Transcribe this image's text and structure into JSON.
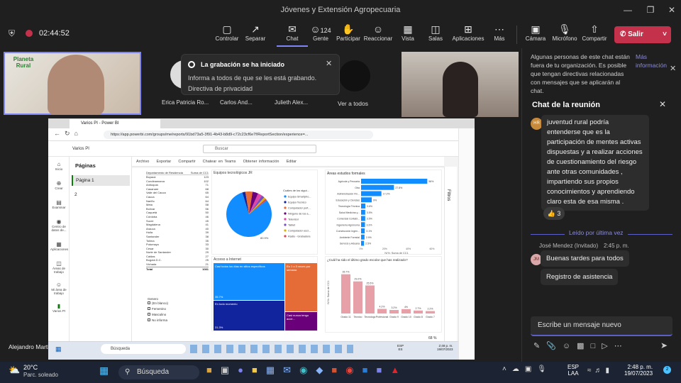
{
  "window": {
    "title": "Jóvenes y Extensión Agropecuaria"
  },
  "meeting": {
    "timer": "02:44:52",
    "participants_count": "124"
  },
  "toolbar": {
    "controlar": "Controlar",
    "separar": "Separar",
    "chat": "Chat",
    "gente": "Gente",
    "participar": "Participar",
    "reaccionar": "Reaccionar",
    "vista": "Vista",
    "salas": "Salas",
    "aplicaciones": "Aplicaciones",
    "mas": "Más",
    "camara": "Cámara",
    "microfono": "Micrófono",
    "compartir": "Compartir",
    "salir": "Salir"
  },
  "recording": {
    "title": "La grabación se ha iniciado",
    "body": "Informa a todos de que se les está grabando.",
    "link": "Directiva de privacidad"
  },
  "participants": {
    "tile_logo": "Planeta Rural",
    "names": [
      "Erica Patricia Ro...",
      "Carlos And...",
      "Julieth Alex..."
    ],
    "ver_todos": "Ver a todos",
    "presenter": "Alejandro Martinez"
  },
  "chat": {
    "notice": "Algunas personas de este chat están fuera de tu organización. Es posible que tengan directivas relacionadas con mensajes que se aplicarán al chat.",
    "notice_link": "Más información",
    "title": "Chat de la reunión",
    "message_text": "juventud rural podría entenderse que es la participación de mentes activas dispuestas y a realizar acciones de cuestionamiento del riesgo ante otras comunidades , impartiendo sus propios conocimientos y aprendiendo claro esta de esa misma .",
    "avatar_initials": "HR",
    "reaction_count": "3",
    "read_marker": "Leído por última vez",
    "sender": "José Mendez (Invitado)",
    "time": "2:45 p. m.",
    "sender_initials": "JM",
    "msg1": "Buenas tardes para todos",
    "msg2": "Registro de asistencia",
    "input_placeholder": "Escribe un mensaje nuevo"
  },
  "browser": {
    "tab": "Varios PI - Power BI",
    "url": "https://app.powerbi.com/groups/me/reports/91bd73a5-3f91-4b43-b8d9-c72c23cf6e7f/ReportSection/experience=...",
    "workspace": "Varios PI",
    "search": "Buscar",
    "menu": [
      "Archivo",
      "Exportar",
      "Compartir",
      "Chatear en Teams",
      "Obtener información",
      "Editar"
    ],
    "pages_title": "Páginas",
    "pages": [
      "Página 1",
      "2"
    ],
    "filters": "Filtros",
    "zoom": "68 %"
  },
  "leftnav": [
    "Inicio",
    "Crear",
    "Examinar",
    "Centro de datos de...",
    "Aplicaciones",
    "Áreas de trabajo",
    "Mi área de trabajo",
    "Varios PI"
  ],
  "table": {
    "headers": [
      "Departamento de Residencia",
      "Suma de CC1"
    ],
    "rows": [
      [
        "Boyacá",
        "123"
      ],
      [
        "Cundinamarca",
        "102"
      ],
      [
        "Antioquia",
        "71"
      ],
      [
        "Casanare",
        "68"
      ],
      [
        "Valle del Cauca",
        "65"
      ],
      [
        "Cauca",
        "64"
      ],
      [
        "Nariño",
        "64"
      ],
      [
        "Meta",
        "58"
      ],
      [
        "Bolívar",
        "56"
      ],
      [
        "Caquetá",
        "50"
      ],
      [
        "Córdoba",
        "46"
      ],
      [
        "Sucre",
        "45"
      ],
      [
        "Magdalena",
        "41"
      ],
      [
        "Arauca",
        "40"
      ],
      [
        "Huila",
        "39"
      ],
      [
        "Santander",
        "38"
      ],
      [
        "Tolima",
        "35"
      ],
      [
        "Putumayo",
        "33"
      ],
      [
        "Cesar",
        "30"
      ],
      [
        "Norte de Santander",
        "29"
      ],
      [
        "Caldas",
        "27"
      ],
      [
        "Bogotá D.C.",
        "25"
      ],
      [
        "Vichada",
        "21"
      ]
    ],
    "total_label": "Total",
    "total": "1081",
    "filter_title": "Genero",
    "filter_options": [
      "(En blanco)",
      "Femenino",
      "Masculino",
      "No informa"
    ]
  },
  "chart_pie": {
    "title": "Equipos tecnológicos JR",
    "legend_title": "Cuáles de los sigui...",
    "legend": [
      "Equipo Smartpho...",
      "Equipo Tecnico",
      "Computador port...",
      "Ninguno de los a...",
      "Televisor",
      "Tablet",
      "Computador escr...",
      "Radio - Grabadora"
    ],
    "colors": [
      "#118dff",
      "#12239e",
      "#e66c37",
      "#6b007b",
      "#e044a7",
      "#744ec2",
      "#d9b300",
      "#d64550"
    ]
  },
  "chart_data": [
    {
      "type": "pie",
      "title": "Equipos tecnológicos JR",
      "labels": [
        "Equipo Smartpho...",
        "Equipo Tecnico",
        "Computador port...",
        "Ninguno de los a...",
        "Televisor",
        "Tablet",
        "Computador escr...",
        "Radio - Grabadora"
      ],
      "values": [
        80.9,
        2.2,
        5.1,
        4.1,
        3.0,
        2.1,
        1.5,
        1.1
      ]
    },
    {
      "type": "bar",
      "title": "Áreas estudios formales",
      "xlabel": "N/%: Suma de CC1",
      "categories": [
        "Agrícola y Pecuaria",
        "Otra",
        "Administración Fin...",
        "Educación y Ciencias",
        "Tecnología Técnica",
        "Salud Medicina y...",
        "Comercial Contabi...",
        "Ingeniería Agrónoma",
        "Construcción Ingen...",
        "Ambiente Forestal",
        "Servicio y Aduana"
      ],
      "values": [
        56.0,
        27.8,
        17.2,
        9.0,
        3.6,
        3.5,
        3.5,
        3.3,
        3.1,
        2.9,
        2.5
      ],
      "xlim": [
        0,
        60
      ]
    },
    {
      "type": "bar",
      "title": "¿Cuál ha sido el último grado escolar que has realizado?",
      "ylabel": "N/%: Suma de CC1",
      "categories": [
        "Grado 11",
        "Tecnico",
        "Tecnólogo",
        "Profesional",
        "Grado 9",
        "Grado 10",
        "Grado 8",
        "Grado 7"
      ],
      "values": [
        35.7,
        29.2,
        25.5,
        4.2,
        3.2,
        4.0,
        2.7,
        2.2
      ],
      "ylim": [
        0,
        40
      ]
    }
  ],
  "treemap": {
    "title": "Acceso a Internet",
    "cells": [
      "Casi todos los días en sitios específicos",
      "En 1 o 3 veces por semana",
      "En todo momento",
      "Casi nunca tengo acce..."
    ],
    "values": [
      "35.7%",
      "",
      "31.3%",
      ""
    ]
  },
  "win_taskbar": {
    "weather": "20°C",
    "weather_desc": "Parc. soleado",
    "search": "Búsqueda",
    "lang": "ESP",
    "lang2": "LAA",
    "time": "2:48 p. m.",
    "date": "19/07/2023"
  },
  "win_taskbar_inner": {
    "search": "Búsqueda",
    "lang": "ESP",
    "lang2": "ES",
    "time": "2:48 p. m.",
    "date": "19/07/2023"
  }
}
